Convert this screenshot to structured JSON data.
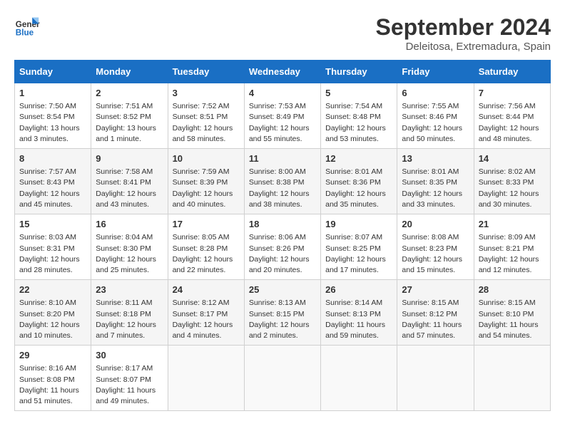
{
  "header": {
    "logo_line1": "General",
    "logo_line2": "Blue",
    "month_title": "September 2024",
    "location": "Deleitosa, Extremadura, Spain"
  },
  "days_of_week": [
    "Sunday",
    "Monday",
    "Tuesday",
    "Wednesday",
    "Thursday",
    "Friday",
    "Saturday"
  ],
  "weeks": [
    [
      {
        "day": "1",
        "sunrise": "7:50 AM",
        "sunset": "8:54 PM",
        "daylight": "13 hours and 3 minutes."
      },
      {
        "day": "2",
        "sunrise": "7:51 AM",
        "sunset": "8:52 PM",
        "daylight": "13 hours and 1 minute."
      },
      {
        "day": "3",
        "sunrise": "7:52 AM",
        "sunset": "8:51 PM",
        "daylight": "12 hours and 58 minutes."
      },
      {
        "day": "4",
        "sunrise": "7:53 AM",
        "sunset": "8:49 PM",
        "daylight": "12 hours and 55 minutes."
      },
      {
        "day": "5",
        "sunrise": "7:54 AM",
        "sunset": "8:48 PM",
        "daylight": "12 hours and 53 minutes."
      },
      {
        "day": "6",
        "sunrise": "7:55 AM",
        "sunset": "8:46 PM",
        "daylight": "12 hours and 50 minutes."
      },
      {
        "day": "7",
        "sunrise": "7:56 AM",
        "sunset": "8:44 PM",
        "daylight": "12 hours and 48 minutes."
      }
    ],
    [
      {
        "day": "8",
        "sunrise": "7:57 AM",
        "sunset": "8:43 PM",
        "daylight": "12 hours and 45 minutes."
      },
      {
        "day": "9",
        "sunrise": "7:58 AM",
        "sunset": "8:41 PM",
        "daylight": "12 hours and 43 minutes."
      },
      {
        "day": "10",
        "sunrise": "7:59 AM",
        "sunset": "8:39 PM",
        "daylight": "12 hours and 40 minutes."
      },
      {
        "day": "11",
        "sunrise": "8:00 AM",
        "sunset": "8:38 PM",
        "daylight": "12 hours and 38 minutes."
      },
      {
        "day": "12",
        "sunrise": "8:01 AM",
        "sunset": "8:36 PM",
        "daylight": "12 hours and 35 minutes."
      },
      {
        "day": "13",
        "sunrise": "8:01 AM",
        "sunset": "8:35 PM",
        "daylight": "12 hours and 33 minutes."
      },
      {
        "day": "14",
        "sunrise": "8:02 AM",
        "sunset": "8:33 PM",
        "daylight": "12 hours and 30 minutes."
      }
    ],
    [
      {
        "day": "15",
        "sunrise": "8:03 AM",
        "sunset": "8:31 PM",
        "daylight": "12 hours and 28 minutes."
      },
      {
        "day": "16",
        "sunrise": "8:04 AM",
        "sunset": "8:30 PM",
        "daylight": "12 hours and 25 minutes."
      },
      {
        "day": "17",
        "sunrise": "8:05 AM",
        "sunset": "8:28 PM",
        "daylight": "12 hours and 22 minutes."
      },
      {
        "day": "18",
        "sunrise": "8:06 AM",
        "sunset": "8:26 PM",
        "daylight": "12 hours and 20 minutes."
      },
      {
        "day": "19",
        "sunrise": "8:07 AM",
        "sunset": "8:25 PM",
        "daylight": "12 hours and 17 minutes."
      },
      {
        "day": "20",
        "sunrise": "8:08 AM",
        "sunset": "8:23 PM",
        "daylight": "12 hours and 15 minutes."
      },
      {
        "day": "21",
        "sunrise": "8:09 AM",
        "sunset": "8:21 PM",
        "daylight": "12 hours and 12 minutes."
      }
    ],
    [
      {
        "day": "22",
        "sunrise": "8:10 AM",
        "sunset": "8:20 PM",
        "daylight": "12 hours and 10 minutes."
      },
      {
        "day": "23",
        "sunrise": "8:11 AM",
        "sunset": "8:18 PM",
        "daylight": "12 hours and 7 minutes."
      },
      {
        "day": "24",
        "sunrise": "8:12 AM",
        "sunset": "8:17 PM",
        "daylight": "12 hours and 4 minutes."
      },
      {
        "day": "25",
        "sunrise": "8:13 AM",
        "sunset": "8:15 PM",
        "daylight": "12 hours and 2 minutes."
      },
      {
        "day": "26",
        "sunrise": "8:14 AM",
        "sunset": "8:13 PM",
        "daylight": "11 hours and 59 minutes."
      },
      {
        "day": "27",
        "sunrise": "8:15 AM",
        "sunset": "8:12 PM",
        "daylight": "11 hours and 57 minutes."
      },
      {
        "day": "28",
        "sunrise": "8:15 AM",
        "sunset": "8:10 PM",
        "daylight": "11 hours and 54 minutes."
      }
    ],
    [
      {
        "day": "29",
        "sunrise": "8:16 AM",
        "sunset": "8:08 PM",
        "daylight": "11 hours and 51 minutes."
      },
      {
        "day": "30",
        "sunrise": "8:17 AM",
        "sunset": "8:07 PM",
        "daylight": "11 hours and 49 minutes."
      },
      null,
      null,
      null,
      null,
      null
    ]
  ],
  "labels": {
    "sunrise": "Sunrise:",
    "sunset": "Sunset:",
    "daylight": "Daylight:"
  }
}
